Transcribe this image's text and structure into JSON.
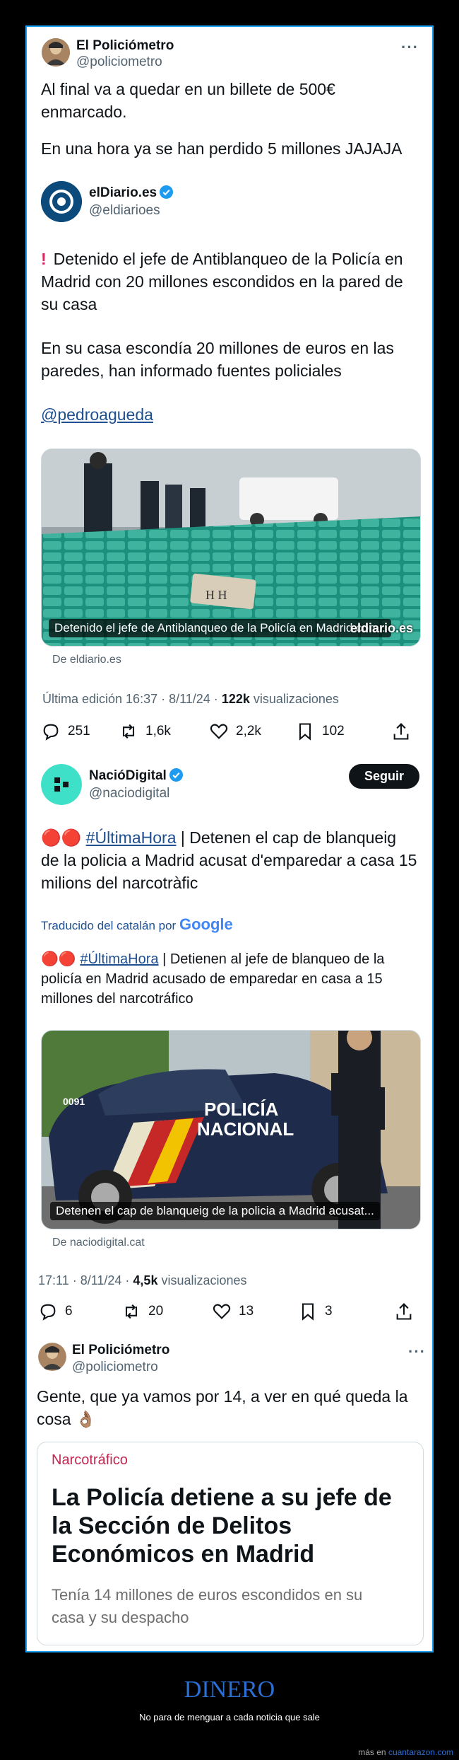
{
  "tweet1": {
    "name": "El Policiómetro",
    "handle": "@policiometro",
    "text_line1": "Al final va a quedar en un billete de 500€",
    "text_line2": "enmarcado.",
    "text_line3": "En una hora ya se han perdido 5 millones JAJAJA",
    "more": "···"
  },
  "quote1": {
    "name": "elDiario.es",
    "handle": "@eldiarioes",
    "line1": "Detenido el jefe de Antiblanqueo de la Policía en",
    "line2": "Madrid con 20 millones escondidos en la pared de",
    "line3": "su casa",
    "line4": "En su casa escondía 20 millones de euros en las",
    "line5": "paredes, han informado fuentes policiales",
    "mention": "@pedroagueda",
    "image_caption": "Detenido el jefe de Antiblanqueo de la Policía en Madrid con...",
    "image_watermark": "eldiario.es",
    "from": "De eldiario.es",
    "meta_prefix": "Última edición 16:37 · 8/11/24 · ",
    "views": "122k",
    "views_label": " visualizaciones",
    "replies": "251",
    "retweets": "1,6k",
    "likes": "2,2k",
    "bookmarks": "102"
  },
  "quote2": {
    "name": "NacióDigital",
    "handle": "@naciodigital",
    "follow": "Seguir",
    "emoji": "🔴🔴",
    "hashtag": "#ÚltimaHora",
    "line1_rest": " |  Detenen el cap de blanqueig",
    "line2": "de la policia a Madrid acusat d'emparedar a casa 15",
    "line3": "milions del narcotràfic",
    "translated_by": "Traducido del catalán por",
    "google": "Google",
    "tr_line1_rest": " | Detienen al jefe de blanqueo de la",
    "tr_line2": "policía en Madrid acusado de emparedar en casa a 15",
    "tr_line3": "millones del narcotráfico",
    "image_caption": "Detenen el cap de blanqueig de la policia a Madrid acusat...",
    "car_text1": "POLICÍA",
    "car_text2": "NACIONAL",
    "car_number": "0091",
    "from": "De naciodigital.cat",
    "meta_prefix": "17:11 · 8/11/24 · ",
    "views": "4,5k",
    "views_label": " visualizaciones",
    "replies": "6",
    "retweets": "20",
    "likes": "13",
    "bookmarks": "3"
  },
  "tweet2": {
    "name": "El Policiómetro",
    "handle": "@policiometro",
    "text_line1": "Gente, que ya vamos por 14, a ver en qué queda la",
    "text_line2": "cosa 👌🏽",
    "more": "···"
  },
  "article": {
    "section": "Narcotráfico",
    "title_line1": "La Policía detiene a su jefe de",
    "title_line2": "la Sección de Delitos",
    "title_line3": "Económicos en Madrid",
    "sub_line1": "Tenía 14 millones de euros escondidos en su",
    "sub_line2": "casa y su despacho"
  },
  "footer": {
    "title": "DINERO",
    "subtitle": "No para de menguar a cada noticia que sale",
    "credit_prefix": "más en ",
    "credit_site": "cuantarazon.com"
  },
  "colors": {
    "accent_border": "#1da1f2",
    "link": "#1d4f91",
    "article_section": "#c0264f",
    "footer_title": "#2b6fd4"
  }
}
